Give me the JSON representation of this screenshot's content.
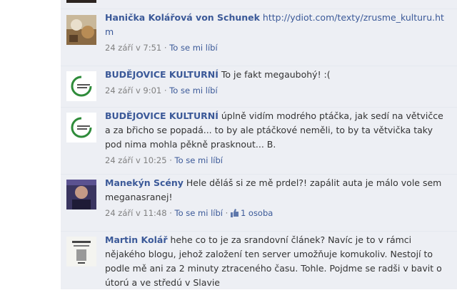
{
  "comments": [
    {
      "author": "Hanička Kolářová von Schunek",
      "text": "",
      "link": "http://ydiot.com/texty/zrusme_kulturu.htm",
      "time": "24 září v 7:51",
      "like_label": "To se mi líbí",
      "avatar_icon": "profile-photo-icon"
    },
    {
      "author": "BUDĚJOVICE KULTURNÍ",
      "text": "To je fakt megaubohý! :(",
      "time": "24 září v 9:01",
      "like_label": "To se mi líbí",
      "avatar_icon": "budejovice-kulturni-logo-icon"
    },
    {
      "author": "BUDĚJOVICE KULTURNÍ",
      "text": "úplně vidím modrého ptáčka, jak sedí na větvičce a za břicho se popadá... to by ale ptáčkové neměli, to by ta větvička taky pod nima mohla pěkně prasknout... B.",
      "time": "24 září v 10:25",
      "like_label": "To se mi líbí",
      "avatar_icon": "budejovice-kulturni-logo-icon"
    },
    {
      "author": "Manekýn Scény",
      "text": "Hele děláš si ze mě prdel?! zapálit auta je málo vole sem meganasranej!",
      "time": "24 září v 11:48",
      "like_label": "To se mi líbí",
      "likes_count": "1 osoba",
      "avatar_icon": "profile-photo-icon"
    },
    {
      "author": "Martin Kolář",
      "text": "hehe co to je za srandovní článek? Navíc je to v rámci nějakého blogu, jehož založení ten server umožňuje komukoliv. Nestojí to podle mě ani za 2 minuty ztraceného času. Tohle. Pojdme se radši v bavit o útorú a ve středú v Slavie",
      "avatar_icon": "profile-photo-icon"
    }
  ],
  "colors": {
    "panel_bg": "#edeff4",
    "author": "#3b5998",
    "meta": "#808080",
    "text": "#333333"
  }
}
